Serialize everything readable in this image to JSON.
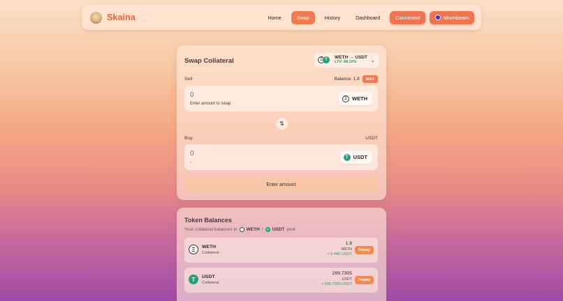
{
  "header": {
    "brand": "Skaina",
    "nav": [
      "Home",
      "Swap",
      "History",
      "Dashboard"
    ],
    "active_nav": "Swap",
    "connected_label": "Connected",
    "network_label": "Moonbeam"
  },
  "swap": {
    "title": "Swap Collateral",
    "pair": {
      "name": "WETH → USDT",
      "ltv": "LTV: 88.10%"
    },
    "sell": {
      "label": "Sell",
      "balance": "Balance: 1.8",
      "max_label": "MAX",
      "amount_placeholder": "0",
      "sub": "Enter amount to swap",
      "token": "WETH"
    },
    "buy": {
      "label": "Buy",
      "token_label": "USDT",
      "amount_placeholder": "0",
      "sub": "-",
      "token": "USDT"
    },
    "submit_label": "Enter amount"
  },
  "balances": {
    "title": "Token Balances",
    "sub_prefix": "Your collateral balances in",
    "sub_token_a": "WETH",
    "sub_sep": "/",
    "sub_token_b": "USDT",
    "sub_suffix": "pool",
    "rows": [
      {
        "token": "WETH",
        "type": "Collateral",
        "amount": "1.8",
        "unit": "WETH",
        "usd": "≈ 5.44K USDT",
        "action": "Repay"
      },
      {
        "token": "USDT",
        "type": "Collateral",
        "amount": "299.7305",
        "unit": "USDT",
        "usd": "≈ 299.7305 USDT",
        "action": "Repay"
      }
    ]
  },
  "colors": {
    "accent": "#ee7a50",
    "usdt": "#26a17b",
    "positive": "#2f9a55"
  },
  "icons": {
    "eth": "eth-icon",
    "usdt": "usdt-icon",
    "swap": "swap-arrows-icon",
    "chevron": "chevron-down-icon"
  }
}
